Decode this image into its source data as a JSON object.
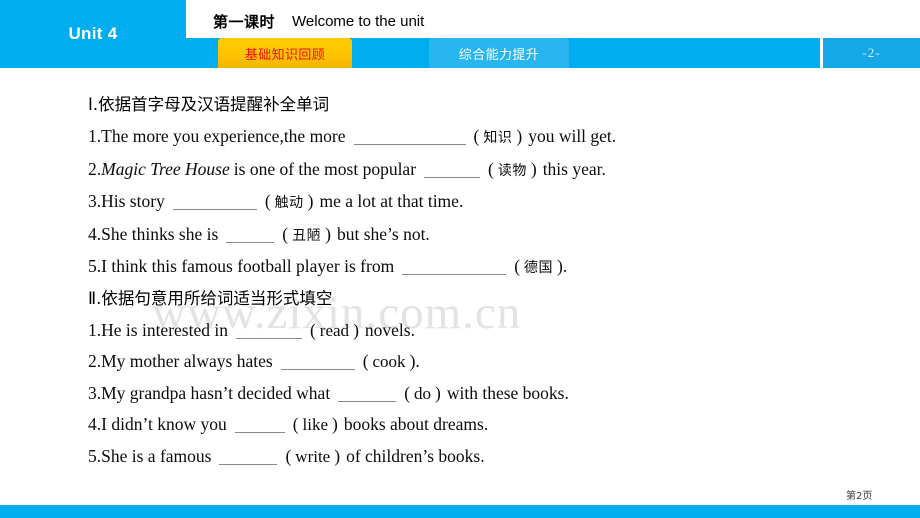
{
  "header": {
    "unit_label": "Unit 4",
    "lesson_cn": "第一课时",
    "lesson_en": "Welcome to the unit",
    "tabs": [
      {
        "label": "基础知识回顾",
        "state": "active"
      },
      {
        "label": "综合能力提升",
        "state": "idle"
      }
    ],
    "page_chip": "-2-"
  },
  "watermark": "www.zixin.com.cn",
  "sections": [
    {
      "heading": "Ⅰ.依据首字母及汉语提醒补全单词",
      "items": [
        {
          "number": "1.",
          "pre": "The more you experience,the more",
          "blank_width": 112,
          "hint": "知识",
          "post": "you will get."
        },
        {
          "number": "2.",
          "italic": "Magic Tree House",
          "pre": "is one of the most popular",
          "blank_width": 56,
          "hint": "读物",
          "post": "this year."
        },
        {
          "number": "3.",
          "pre": "His story",
          "blank_width": 84,
          "hint": "触动",
          "post": "me a lot at that time."
        },
        {
          "number": "4.",
          "pre": "She thinks she is",
          "blank_width": 48,
          "hint": "丑陋",
          "post": "but she’s not."
        },
        {
          "number": "5.",
          "pre": "I think this famous football player is from",
          "blank_width": 104,
          "hint": "德国",
          "post": "."
        }
      ]
    },
    {
      "heading": "Ⅱ.依据句意用所给词适当形式填空",
      "items": [
        {
          "number": "1.",
          "pre": "He is interested in",
          "blank_width": 66,
          "hint": "read",
          "hint_latin": true,
          "post": "novels."
        },
        {
          "number": "2.",
          "pre": "My mother always hates",
          "blank_width": 74,
          "hint": "cook",
          "hint_latin": true,
          "post": "."
        },
        {
          "number": "3.",
          "pre": "My grandpa hasn’t decided what",
          "blank_width": 58,
          "hint": "do",
          "hint_latin": true,
          "post": "with these books."
        },
        {
          "number": "4.",
          "pre": "I didn’t know you",
          "blank_width": 50,
          "hint": "like",
          "hint_latin": true,
          "post": "books about dreams."
        },
        {
          "number": "5.",
          "pre": "She is a famous",
          "blank_width": 58,
          "hint": "write",
          "hint_latin": true,
          "post": "of children’s books."
        }
      ]
    }
  ],
  "footer": {
    "page_label": "第2页"
  },
  "colors": {
    "brand_blue": "#00AEEF",
    "tab_active_yellow": "#FFC400",
    "tab_active_text_red": "#E8100C",
    "tab_idle_blue": "#29B6F0",
    "watermark_gray": "#E3E3E6",
    "blank_line_gray": "#8a8a8a"
  }
}
